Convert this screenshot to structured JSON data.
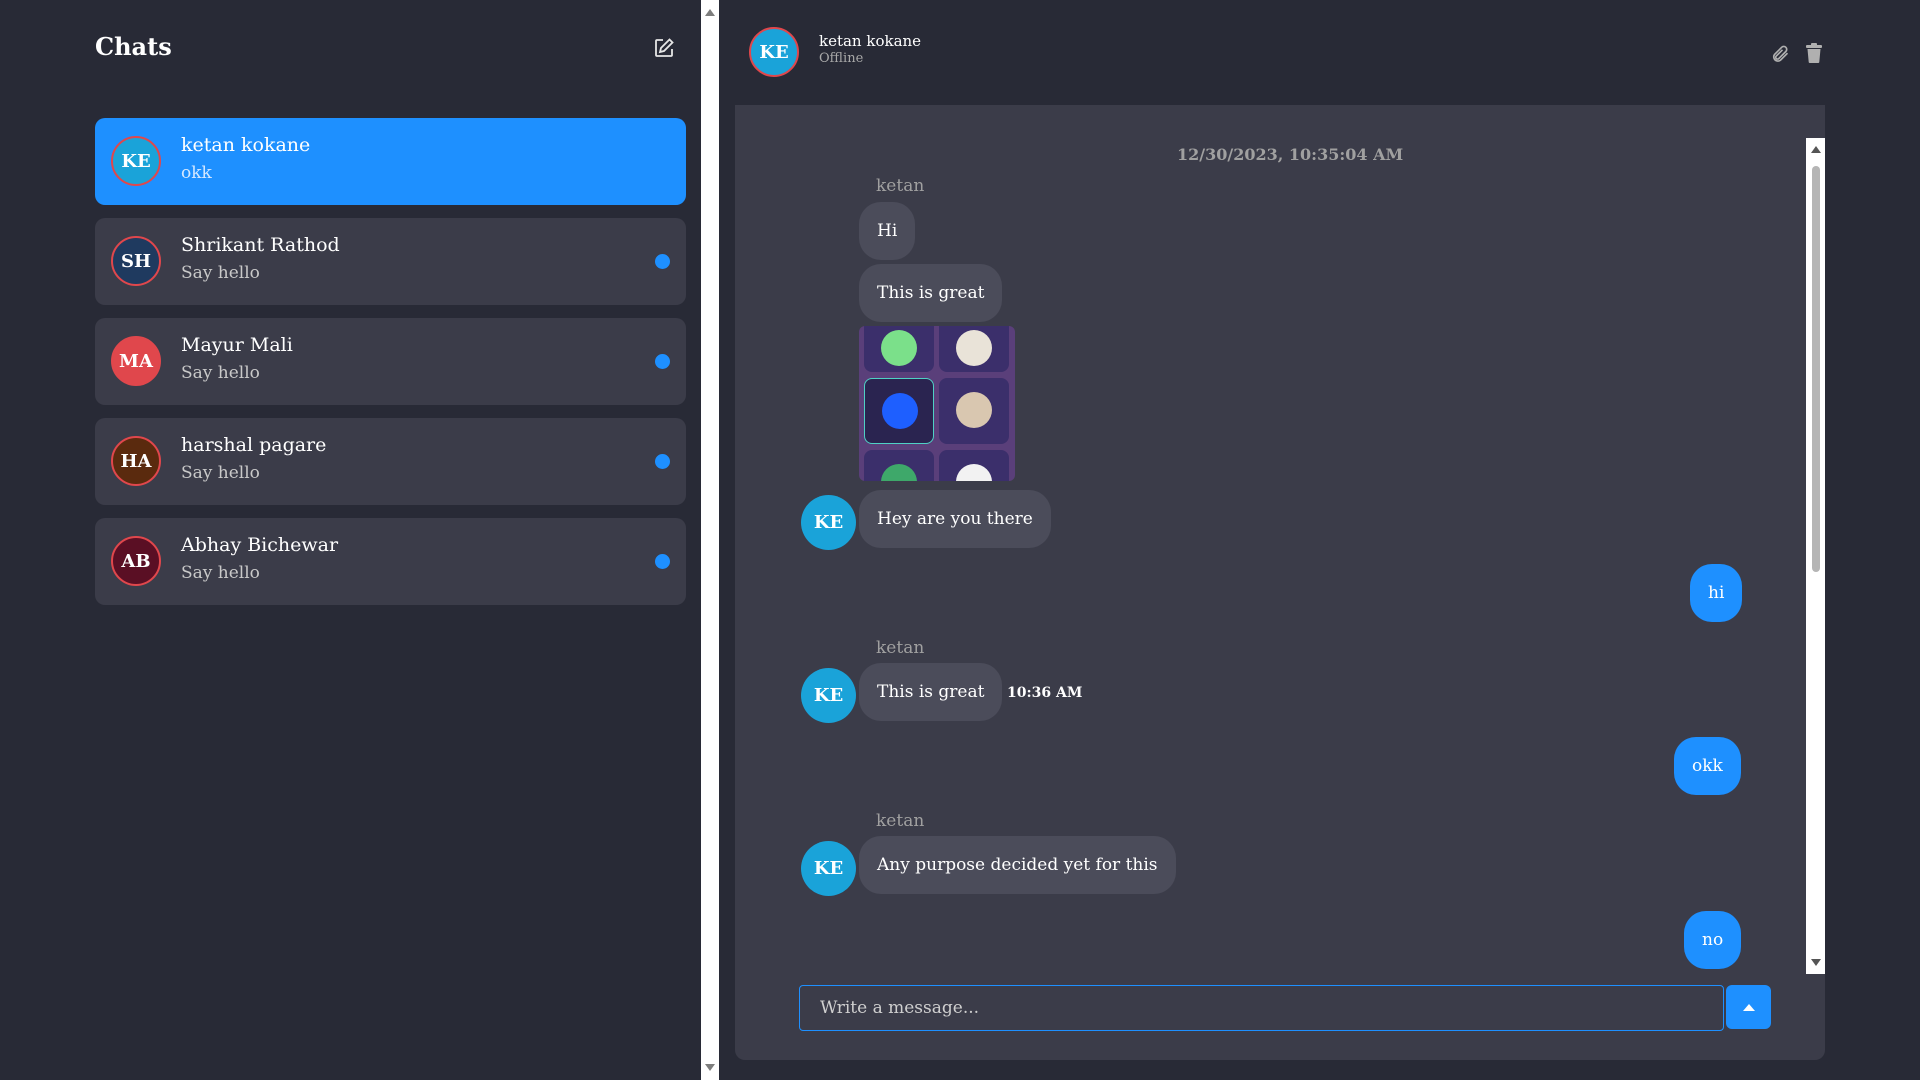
{
  "sidebar": {
    "title": "Chats",
    "compose_icon": "compose-icon",
    "chats": [
      {
        "initials": "KE",
        "name": "ketan kokane",
        "preview": "okk",
        "avatar_color": "#1aa3d9",
        "active": true,
        "unread": false
      },
      {
        "initials": "SH",
        "name": "Shrikant Rathod",
        "preview": "Say hello",
        "avatar_color": "#1f3a5f",
        "active": false,
        "unread": true
      },
      {
        "initials": "MA",
        "name": "Mayur Mali",
        "preview": "Say hello",
        "avatar_color": "#e0474c",
        "active": false,
        "unread": true
      },
      {
        "initials": "HA",
        "name": "harshal pagare",
        "preview": "Say hello",
        "avatar_color": "#5a2a0e",
        "active": false,
        "unread": true
      },
      {
        "initials": "AB",
        "name": "Abhay Bichewar",
        "preview": "Say hello",
        "avatar_color": "#5a0f24",
        "active": false,
        "unread": true
      }
    ]
  },
  "conversation": {
    "header": {
      "initials": "KE",
      "name": "ketan kokane",
      "status": "Offline",
      "attach_icon": "paperclip-icon",
      "delete_icon": "trash-icon"
    },
    "date_stamp": "12/30/2023, 10:35:04 AM",
    "messages": {
      "sender_1": "ketan",
      "m1": "Hi",
      "m2": "This is great",
      "m3": "Hey are you there",
      "m4": "hi",
      "sender_2": "ketan",
      "m5": "This is great",
      "m5_time": "10:36 AM",
      "m6": "okk",
      "sender_3": "ketan",
      "m7": "Any purpose decided yet for this",
      "m8": "no",
      "avatar_initials": "KE"
    },
    "composer": {
      "placeholder": "Write a message...",
      "send_icon": "send-arrow-icon"
    }
  },
  "colors": {
    "background": "#282a36",
    "panel": "#3b3c49",
    "accent": "#1e90ff",
    "bubble_other": "#4b4c5a"
  }
}
